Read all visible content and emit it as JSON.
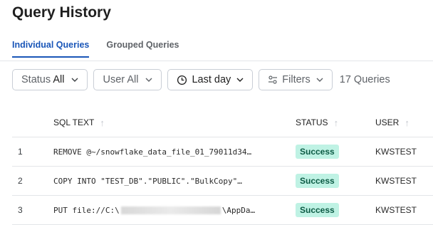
{
  "page": {
    "title": "Query History"
  },
  "tabs": [
    {
      "label": "Individual Queries",
      "active": true
    },
    {
      "label": "Grouped Queries",
      "active": false
    }
  ],
  "filters": {
    "status": {
      "label": "Status",
      "value": "All"
    },
    "user": {
      "label": "User",
      "value": "All"
    },
    "time": {
      "value": "Last day"
    },
    "more": {
      "label": "Filters"
    },
    "count": "17 Queries"
  },
  "table": {
    "columns": {
      "sql": "SQL TEXT",
      "status": "STATUS",
      "user": "USER"
    },
    "rows": [
      {
        "index": "1",
        "sql": "REMOVE @~/snowflake_data_file_01_79011d34…",
        "status": "Success",
        "user": "KWSTEST"
      },
      {
        "index": "2",
        "sql": "COPY INTO \"TEST_DB\".\"PUBLIC\".\"BulkCopy\"…",
        "status": "Success",
        "user": "KWSTEST"
      },
      {
        "index": "3",
        "sql_prefix": "PUT file://C:\\",
        "sql_suffix": "\\AppDa…",
        "status": "Success",
        "user": "KWSTEST"
      }
    ]
  },
  "colors": {
    "accent": "#1a56b8",
    "success_bg": "#bff2e4",
    "success_text": "#0d5b45"
  }
}
